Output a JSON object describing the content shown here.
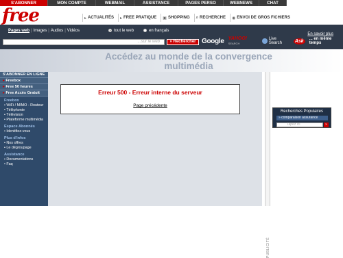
{
  "header": {
    "logo": "free",
    "topnav": [
      {
        "label": "S'ABONNER",
        "active": true
      },
      {
        "label": "MON COMPTE",
        "active": false
      },
      {
        "label": "WEBMAIL",
        "active": false
      },
      {
        "label": "ASSISTANCE",
        "active": false
      },
      {
        "label": "PAGES PERSO",
        "active": false
      },
      {
        "label": "WEBNEWS",
        "active": false
      },
      {
        "label": "CHAT",
        "active": false
      }
    ],
    "subnav": [
      {
        "label": "ACTUALITÉS",
        "icon": "arrow-icon"
      },
      {
        "label": "FREE PRATIQUE",
        "icon": "arrow-icon"
      },
      {
        "label": "SHOPPING",
        "icon": "cart-icon"
      },
      {
        "label": "RECHERCHE",
        "icon": "magnifier-icon"
      },
      {
        "label": "ENVOI DE GROS FICHIERS",
        "icon": "upload-icon"
      }
    ]
  },
  "search": {
    "tabs": [
      "Pages web",
      "Images",
      "Audios",
      "Vidéos"
    ],
    "scope_options": [
      "tout le web",
      "en français"
    ],
    "scope_selected": "tout le web",
    "more_link": "En savoir plus",
    "placeholder": "...sur le web",
    "button": "» Rechercher",
    "partners": {
      "google": "Google",
      "yahoo": "YAHOO!",
      "yahoo_sub": "SEARCH",
      "live": "Live Search",
      "ask": "Ask",
      "suffix": "... en même temps"
    }
  },
  "headline": "Accédez au monde de la convergence multimédia",
  "sidebar": {
    "subscribe_title": "S'ABONNER EN LIGNE",
    "offers": [
      "Freebox",
      "Free 50 heures",
      "Free Accès Gratuit"
    ],
    "sections": [
      {
        "title": "Freebox",
        "links": [
          "WiFi / MIMO - Routeur",
          "Téléphonie",
          "Télévision",
          "Plateforme multimédia"
        ]
      },
      {
        "title": "Espace Abonnés",
        "links": [
          "Identifiez-vous"
        ]
      },
      {
        "title": "Plus d'infos",
        "links": [
          "Nos offres",
          "Le dégroupage"
        ]
      },
      {
        "title": "Assistance",
        "links": [
          "Documentations",
          "Faq"
        ]
      }
    ]
  },
  "main": {
    "error_title": "Erreur 500 - Erreur interne du serveur",
    "back_link": "Page précédente"
  },
  "pub_label": "PUBLICITÉ",
  "popular": {
    "title": "Recherches Populaires",
    "selected": "» comparaison assurance",
    "input_placeholder": "Tapez ici",
    "go": "»"
  },
  "colors": {
    "brand_red": "#cc0000",
    "nav_dark": "#2f3a4a",
    "sidebar_blue": "#2f4a6a",
    "main_bg": "#dde1e7"
  }
}
